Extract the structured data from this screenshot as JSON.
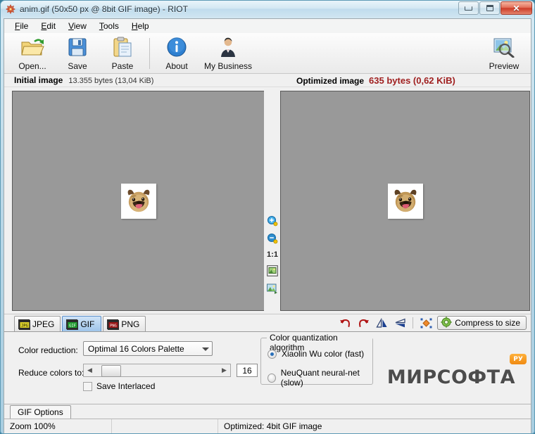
{
  "window": {
    "title": "anim.gif (50x50 px @ 8bit GIF image) - RIOT",
    "icon": "riot-app-icon",
    "buttons": {
      "minimize": "minimize-button",
      "maximize": "maximize-button",
      "close_label": "✕"
    }
  },
  "menubar": {
    "items": [
      {
        "label": "File",
        "accel": "F"
      },
      {
        "label": "Edit",
        "accel": "E"
      },
      {
        "label": "View",
        "accel": "V"
      },
      {
        "label": "Tools",
        "accel": "T"
      },
      {
        "label": "Help",
        "accel": "H"
      }
    ]
  },
  "toolbar": {
    "buttons": [
      {
        "label": "Open...",
        "icon": "open-folder-icon"
      },
      {
        "label": "Save",
        "icon": "floppy-disk-icon"
      },
      {
        "label": "Paste",
        "icon": "clipboard-icon"
      },
      {
        "label": "About",
        "icon": "info-circle-icon"
      },
      {
        "label": "My Business",
        "icon": "businessman-icon"
      }
    ],
    "preview": {
      "label": "Preview",
      "icon": "image-magnifier-icon"
    }
  },
  "panels_header": {
    "initial_label": "Initial image",
    "initial_size": "13.355 bytes (13,04 KiB)",
    "optimized_label": "Optimized image",
    "optimized_size": "635 bytes (0,62 KiB)",
    "optimized_color": "#a02020"
  },
  "mid_tools": {
    "zoom_in": "zoom-in-icon",
    "zoom_out": "zoom-out-icon",
    "ratio_label": "1:1",
    "fit_window": "fit-to-window-icon",
    "actual_size": "original-size-icon"
  },
  "format_tabs": [
    {
      "label": "JPEG",
      "icon": "jpg-format-icon",
      "active": false,
      "color": "#c9b400"
    },
    {
      "label": "GIF",
      "icon": "gif-format-icon",
      "active": true,
      "color": "#1f9b2f"
    },
    {
      "label": "PNG",
      "icon": "png-format-icon",
      "active": false,
      "color": "#9a1414"
    }
  ],
  "tab_tools": [
    {
      "name": "rotate-left-icon",
      "glyph": "↶",
      "color": "#b01414"
    },
    {
      "name": "rotate-right-icon",
      "glyph": "↷",
      "color": "#b01414"
    },
    {
      "name": "flip-horizontal-icon",
      "glyph": "◢",
      "color": "#1a3f8f"
    },
    {
      "name": "flip-vertical-icon",
      "glyph": "◤",
      "color": "#1a3f8f"
    },
    {
      "name": "resize-image-icon",
      "glyph": "✥",
      "color": "#e07000"
    }
  ],
  "compress_button": {
    "label": "Compress to size",
    "icon": "gear-compress-icon"
  },
  "gif_options": {
    "color_reduction_label": "Color reduction:",
    "color_reduction_value": "Optimal 16 Colors Palette",
    "reduce_colors_label": "Reduce colors to:",
    "reduce_colors_value": "16",
    "save_interlaced_label": "Save Interlaced",
    "save_interlaced_checked": false,
    "quantization": {
      "group_label": "Color quantization algorithm",
      "options": [
        {
          "label": "Xiaolin Wu color (fast)",
          "selected": true
        },
        {
          "label": "NeuQuant neural-net (slow)",
          "selected": false
        }
      ]
    }
  },
  "bottom_tabs": [
    {
      "label": "GIF Options",
      "active": true
    }
  ],
  "statusbar": {
    "zoom": "Zoom 100%",
    "middle": "",
    "optimized_info": "Optimized: 4bit GIF image"
  },
  "watermark": {
    "text": "МИРСОФТА",
    "badge": "РУ"
  },
  "preview_images": {
    "left_alt": "pug-dog-face-thumbnail",
    "right_alt": "pug-dog-face-thumbnail-optimized"
  }
}
